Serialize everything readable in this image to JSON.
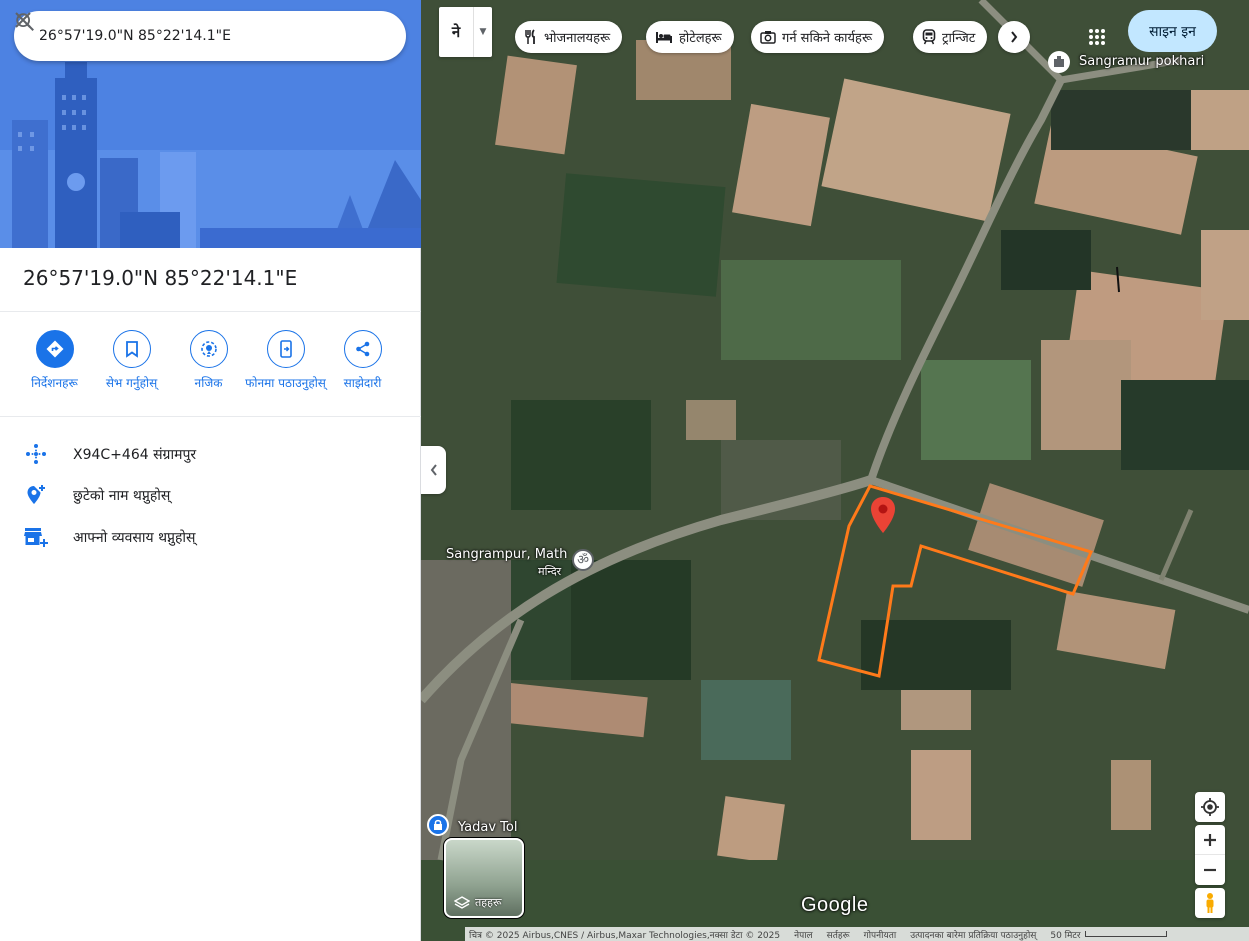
{
  "search": {
    "value": "26°57'19.0\"N 85°22'14.1\"E"
  },
  "place": {
    "title": "26°57'19.0\"N 85°22'14.1\"E"
  },
  "actions": [
    {
      "label": "निर्देशनहरू",
      "icon": "directions-icon"
    },
    {
      "label": "सेभ गर्नुहोस्",
      "icon": "bookmark-icon"
    },
    {
      "label": "नजिक",
      "icon": "nearby-icon"
    },
    {
      "label": "फोनमा पठाउनुहोस्",
      "icon": "send-to-phone-icon"
    },
    {
      "label": "साझेदारी",
      "icon": "share-icon"
    }
  ],
  "info": {
    "plus_code": "X94C+464 संग्रामपुर",
    "add_place": "छुटेको नाम थप्नुहोस्",
    "add_business": "आफ्नो व्यवसाय थप्नुहोस्"
  },
  "map": {
    "language_button": "ने",
    "chips": [
      {
        "label": "भोजनालयहरू",
        "icon": "restaurant-icon"
      },
      {
        "label": "होटेलहरू",
        "icon": "hotel-icon"
      },
      {
        "label": "गर्न सकिने कार्यहरू",
        "icon": "camera-icon"
      },
      {
        "label": "ट्रान्जिट",
        "icon": "transit-icon"
      }
    ],
    "signin": "साइन इन",
    "labels": {
      "pokhari": "Sangramur pokhari",
      "math_line1": "Sangrampur, Math",
      "math_line2": "मन्दिर",
      "yadav": "Yadav Tol"
    },
    "layers_label": "तहहरू",
    "logo": "Google",
    "attribution": {
      "imagery": "चित्र © 2025 Airbus,CNES / Airbus,Maxar Technologies,नक्सा डेटा © 2025",
      "country": "नेपाल",
      "terms": "सर्तहरू",
      "privacy": "गोपनीयता",
      "feedback": "उत्पादनका बारेमा प्रतिक्रिया पठाउनुहोस्",
      "scale": "50 मिटर"
    }
  },
  "colors": {
    "accent": "#1a73e8",
    "hero": "#4a7fe0",
    "pin": "#ea4335",
    "outline": "#ff7a1a"
  }
}
